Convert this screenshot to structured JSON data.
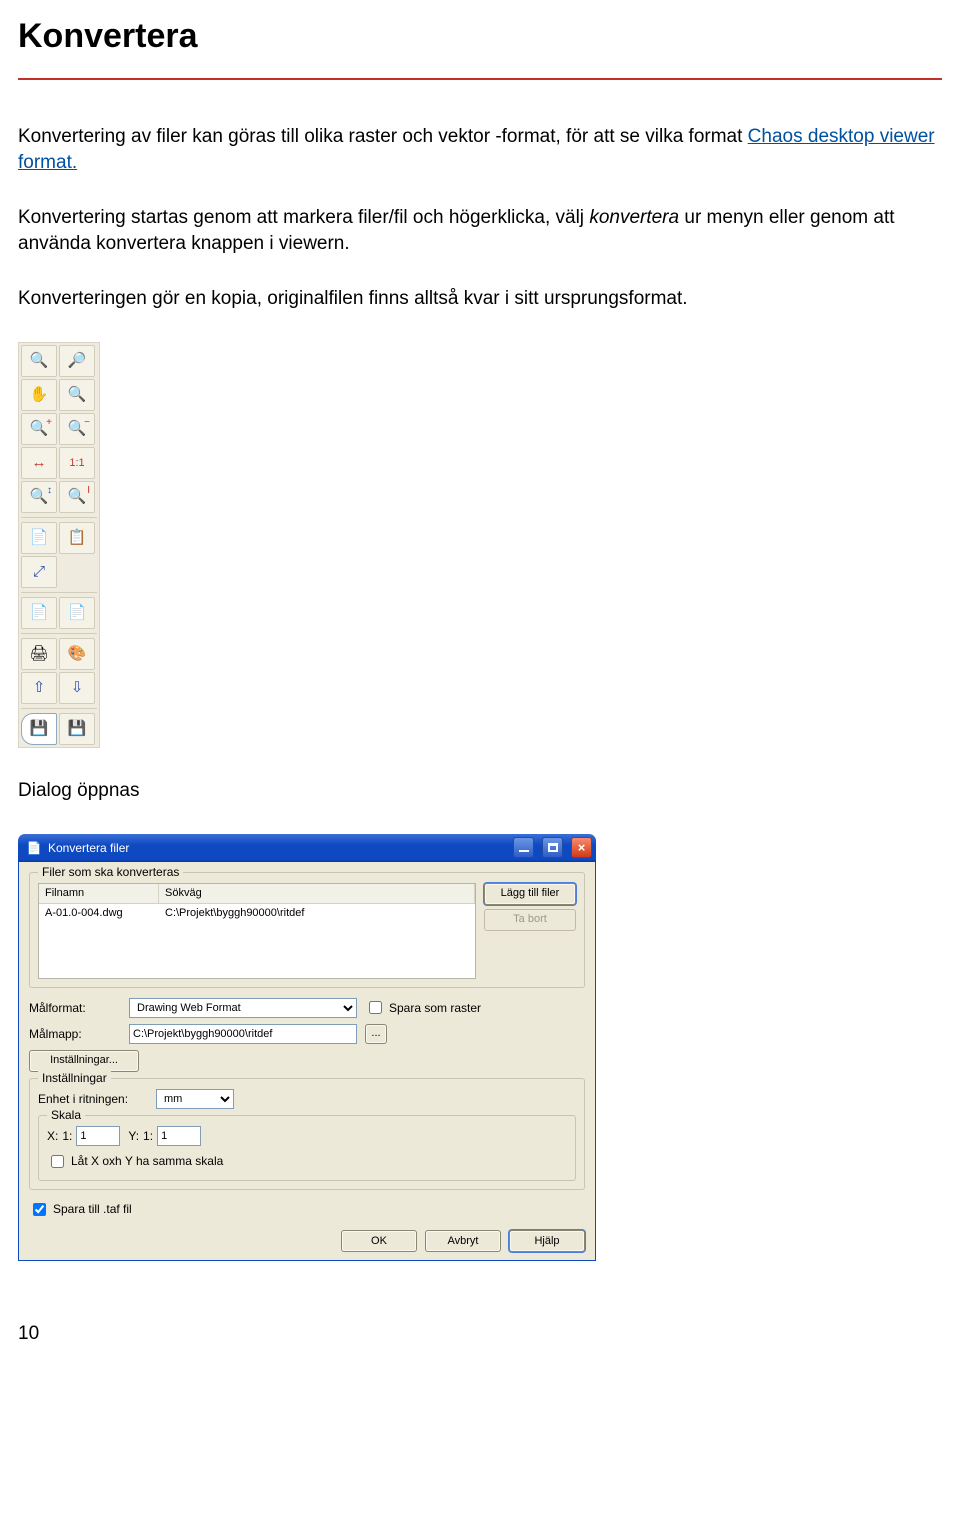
{
  "heading": "Konvertera",
  "para1_a": "Konvertering av filer kan göras till olika raster och vektor -format, för att se vilka format ",
  "para1_link": "Chaos desktop viewer format.",
  "para2_a": "Konvertering startas genom att markera filer/fil och högerklicka, välj ",
  "para2_i": "konvertera",
  "para2_b": " ur menyn eller genom att använda konvertera knappen i viewern.",
  "para3": "Konverteringen gör en kopia, originalfilen finns alltså kvar i sitt ursprungsformat.",
  "dialog_opens": "Dialog öppnas",
  "page_num": "10",
  "toolbar": {
    "zoom_in": "🔍",
    "zoom_out": "🔎",
    "hand": "✋",
    "zoom": "🔍",
    "plus": "+",
    "minus": "−",
    "fit_w": "↔",
    "one_to_one": "1:1",
    "fit_h": "↕",
    "info": "I",
    "layers": "📄",
    "copy": "📋",
    "full": "⤢",
    "page1": "📄",
    "page2": "📄",
    "print": "🖨",
    "palette": "🎨",
    "up": "⇧",
    "down": "⇩",
    "save": "💾",
    "save2": "💾"
  },
  "dialog": {
    "title": "Konvertera filer",
    "group_files_legend": "Filer som ska konverteras",
    "col_filnamn": "Filnamn",
    "col_sokvag": "Sökväg",
    "row_filnamn": "A-01.0-004.dwg",
    "row_sokvag": "C:\\Projekt\\byggh90000\\ritdef",
    "btn_add": "Lägg till filer",
    "btn_remove": "Ta bort",
    "lbl_malformat": "Målformat:",
    "sel_malformat": "Drawing Web Format",
    "chk_spara_raster": "Spara som raster",
    "lbl_malmapp": "Målmapp:",
    "val_malmapp": "C:\\Projekt\\byggh90000\\ritdef",
    "btn_browse": "...",
    "btn_installningar": "Inställningar...",
    "group_settings_legend": "Inställningar",
    "lbl_enhet": "Enhet i ritningen:",
    "sel_enhet": "mm",
    "group_skala_legend": "Skala",
    "lbl_x": "X:",
    "lbl_x_prefix": "1:",
    "val_x": "1",
    "lbl_y": "Y:",
    "lbl_y_prefix": "1:",
    "val_y": "1",
    "chk_same_scale": "Låt X oxh Y ha samma skala",
    "chk_spara_taf": "Spara till .taf fil",
    "btn_ok": "OK",
    "btn_avbryt": "Avbryt",
    "btn_hjalp": "Hjälp"
  }
}
